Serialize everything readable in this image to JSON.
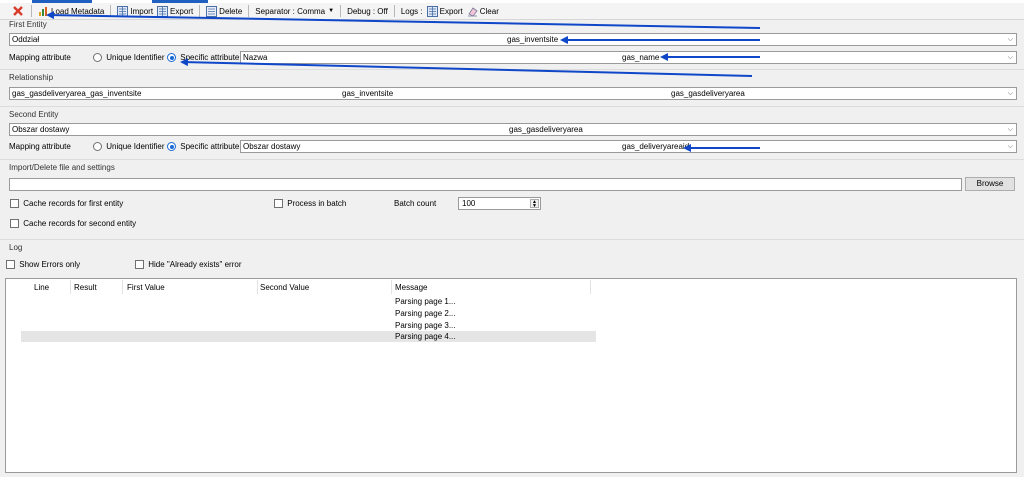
{
  "toolbar": {
    "load_metadata": "Load Metadata",
    "import": "Import",
    "export": "Export",
    "delete": "Delete",
    "separator": "Separator : Comma",
    "debug": "Debug : Off",
    "logs_label": "Logs :",
    "logs_export": "Export",
    "clear": "Clear"
  },
  "first_entity": {
    "title": "First Entity",
    "display": "Oddział",
    "logical": "gas_inventsite",
    "mapping_label": "Mapping attribute",
    "unique_identifier": "Unique Identifier",
    "specific_attribute": "Specific attribute",
    "attr_display": "Nazwa",
    "attr_logical": "gas_name"
  },
  "relationship": {
    "title": "Relationship",
    "name": "gas_gasdeliveryarea_gas_inventsite",
    "entity1": "gas_inventsite",
    "entity2": "gas_gasdeliveryarea"
  },
  "second_entity": {
    "title": "Second Entity",
    "display": "Obszar dostawy",
    "logical": "gas_gasdeliveryarea",
    "mapping_label": "Mapping attribute",
    "unique_identifier": "Unique Identifier",
    "specific_attribute": "Specific attribute",
    "attr_display": "Obszar dostawy",
    "attr_logical": "gas_deliveryareaid"
  },
  "import_settings": {
    "title": "Import/Delete file and settings",
    "file_path": "",
    "browse": "Browse",
    "cache_first": "Cache records for first entity",
    "process_batch": "Process in batch",
    "batch_count_label": "Batch count",
    "batch_count_value": "100",
    "cache_second": "Cache records for second entity"
  },
  "log": {
    "title": "Log",
    "show_errors": "Show Errors only",
    "hide_exists": "Hide \"Already exists\" error",
    "columns": [
      "Line",
      "Result",
      "First Value",
      "Second Value",
      "Message"
    ],
    "rows": [
      {
        "message": "Parsing page 1..."
      },
      {
        "message": "Parsing page 2..."
      },
      {
        "message": "Parsing page 3..."
      },
      {
        "message": "Parsing page 4..."
      }
    ]
  },
  "colors": {
    "accent": "#1a6ad6",
    "arrow": "#0f47c8",
    "selected_row": "#e5e5e5"
  }
}
